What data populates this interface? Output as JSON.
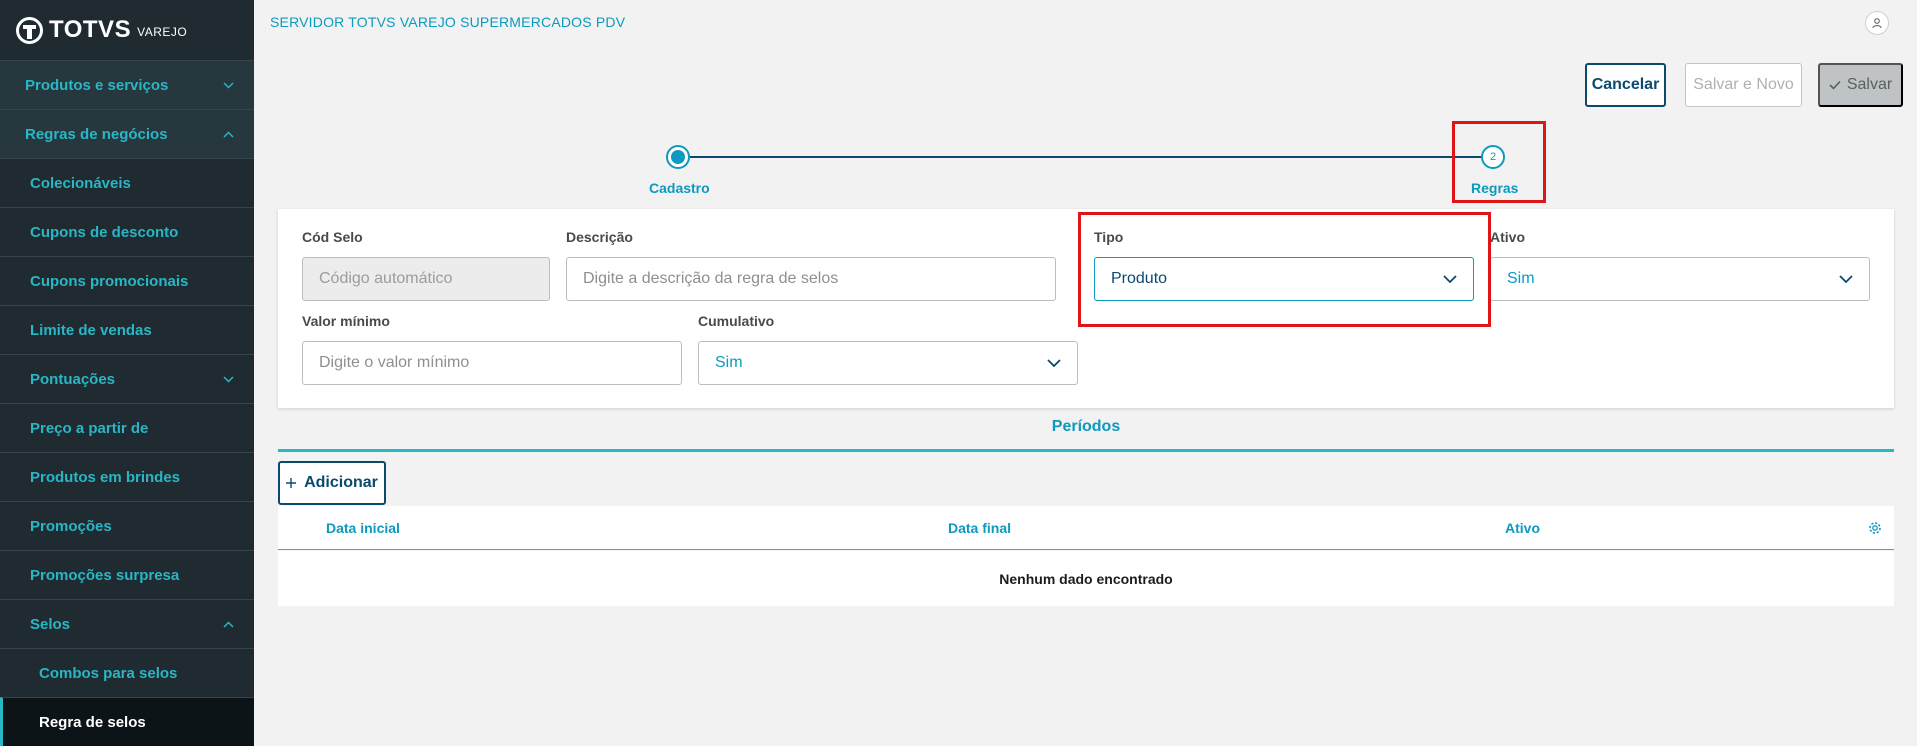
{
  "header": {
    "app_title": "SERVIDOR TOTVS VAREJO SUPERMERCADOS PDV",
    "user_icon": "user-icon"
  },
  "logo": {
    "brand": "TOTVS",
    "sub": "VAREJO"
  },
  "sidebar": {
    "items": [
      {
        "label": "Produtos e serviços",
        "level": 0,
        "chevron": "down"
      },
      {
        "label": "Regras de negócios",
        "level": 0,
        "chevron": "up"
      },
      {
        "label": "Colecionáveis",
        "level": 1,
        "chevron": ""
      },
      {
        "label": "Cupons de desconto",
        "level": 1,
        "chevron": ""
      },
      {
        "label": "Cupons promocionais",
        "level": 1,
        "chevron": ""
      },
      {
        "label": "Limite de vendas",
        "level": 1,
        "chevron": ""
      },
      {
        "label": "Pontuações",
        "level": 1,
        "chevron": "down"
      },
      {
        "label": "Preço a partir de",
        "level": 1,
        "chevron": ""
      },
      {
        "label": "Produtos em brindes",
        "level": 1,
        "chevron": ""
      },
      {
        "label": "Promoções",
        "level": 1,
        "chevron": ""
      },
      {
        "label": "Promoções surpresa",
        "level": 1,
        "chevron": ""
      },
      {
        "label": "Selos",
        "level": 1,
        "chevron": "up"
      },
      {
        "label": "Combos para selos",
        "level": 2,
        "chevron": ""
      },
      {
        "label": "Regra de selos",
        "level": 2,
        "chevron": "",
        "active": true
      }
    ]
  },
  "actions": {
    "cancel": "Cancelar",
    "save_new": "Salvar e Novo",
    "save": "Salvar"
  },
  "stepper": {
    "step1": "Cadastro",
    "step2": "Regras",
    "step2_number": "2"
  },
  "form": {
    "cod_selo": {
      "label": "Cód Selo",
      "placeholder": "Código automático"
    },
    "descricao": {
      "label": "Descrição",
      "placeholder": "Digite a descrição da regra de selos"
    },
    "tipo": {
      "label": "Tipo",
      "value": "Produto"
    },
    "ativo": {
      "label": "Ativo",
      "value": "Sim"
    },
    "valor_minimo": {
      "label": "Valor mínimo",
      "placeholder": "Digite o valor mínimo"
    },
    "cumulativo": {
      "label": "Cumulativo",
      "value": "Sim"
    }
  },
  "periods": {
    "title": "Períodos",
    "add_label": "Adicionar",
    "columns": [
      "Data inicial",
      "Data final",
      "Ativo"
    ],
    "empty_text": "Nenhum dado encontrado"
  },
  "colors": {
    "accent": "#0c9abe",
    "primary_dark": "#0b4a6e",
    "sidebar_bg": "#1f2b30",
    "highlight": "#e01515"
  }
}
